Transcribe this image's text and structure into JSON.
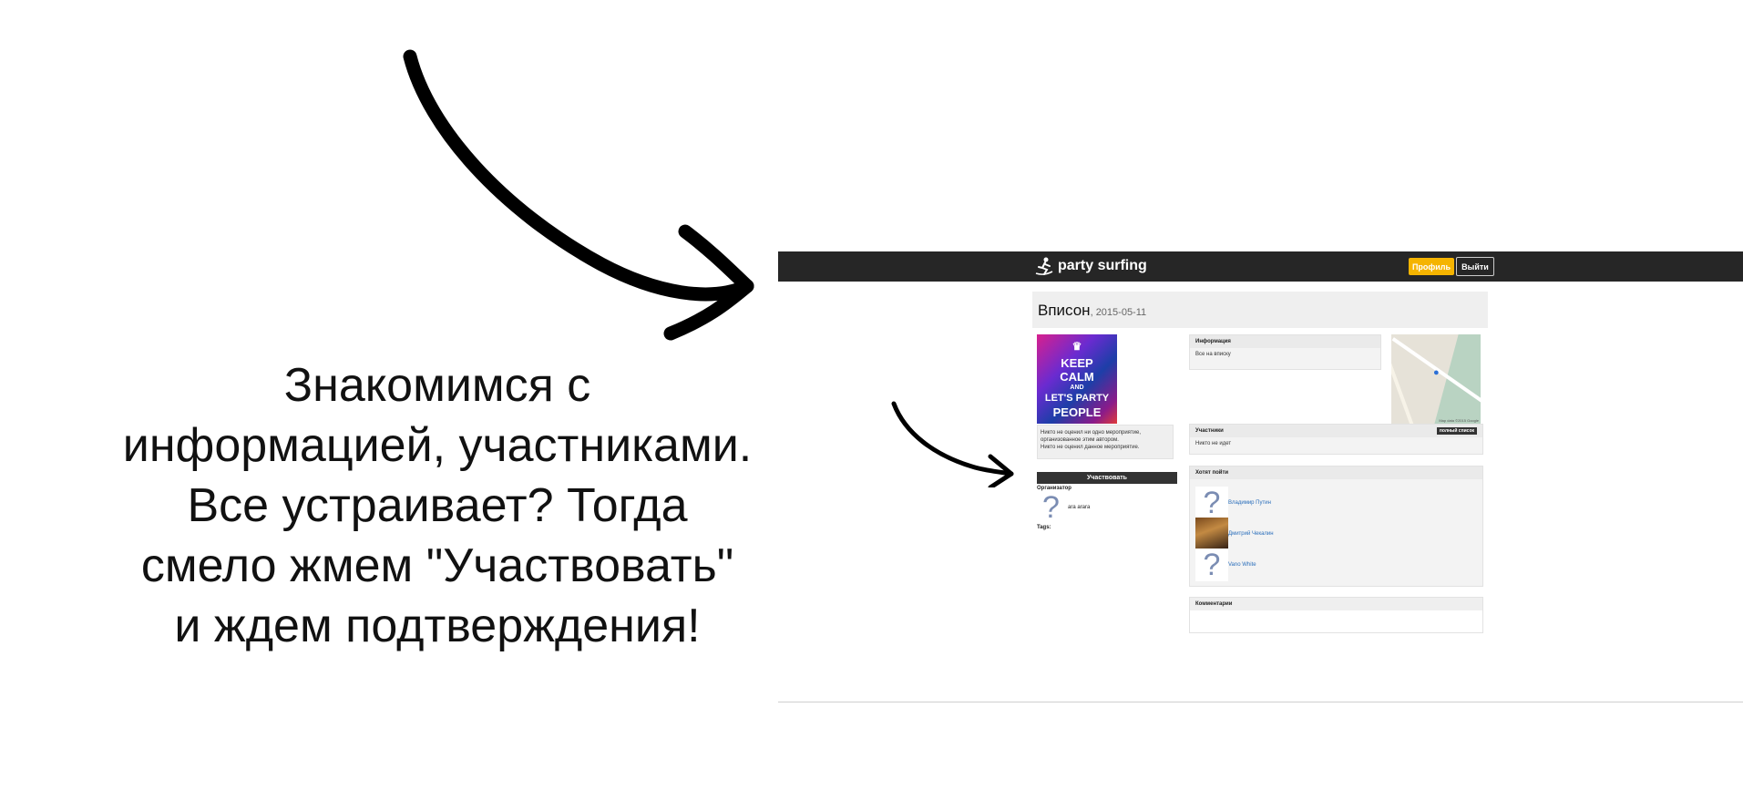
{
  "caption": {
    "lines": [
      "Знакомимся с",
      "информацией, участниками.",
      "Все устраивает? Тогда",
      "смело жмем \"Участвовать\"",
      "и ждем подтверждения!"
    ]
  },
  "colors": {
    "nav": "#262626",
    "accent": "#f5b400",
    "link": "#2a6ebb"
  },
  "app": {
    "logo_text": "party surfing",
    "nav": {
      "profile_label": "Профиль",
      "logout_label": "Выйти"
    }
  },
  "event": {
    "title": "Вписон",
    "date": ", 2015-05-11",
    "poster": {
      "line1": "KEEP",
      "line2": "CALM",
      "line3": "AND",
      "line4": "LET'S PARTY",
      "line5": "PEOPLE"
    },
    "rating_lines": [
      "Никто не оценил ни одно мероприятие,",
      "организованное этим автором.",
      "Никто не оценил данное мероприятие."
    ],
    "join_label": "Участвовать",
    "organizer_label": "Организатор",
    "organizer_name": "ara arara",
    "tags_label": "Tags:"
  },
  "info": {
    "header": "Информация",
    "text": "Все на вписку"
  },
  "map": {
    "icon": "map-pin-icon",
    "copyright": "Map data ©2015 Google"
  },
  "participants": {
    "header": "Участники",
    "full_list_label": "полный список",
    "text": "Никто не идет"
  },
  "want_to_go": {
    "header": "Хотят пойти",
    "people": [
      {
        "name": "Владимир Путин",
        "avatar": "question-mark-avatar"
      },
      {
        "name": "Дмитрий Чекалин",
        "avatar": "photo-avatar"
      },
      {
        "name": "Vano White",
        "avatar": "question-mark-avatar"
      }
    ]
  },
  "comments": {
    "header": "Комментарии"
  }
}
